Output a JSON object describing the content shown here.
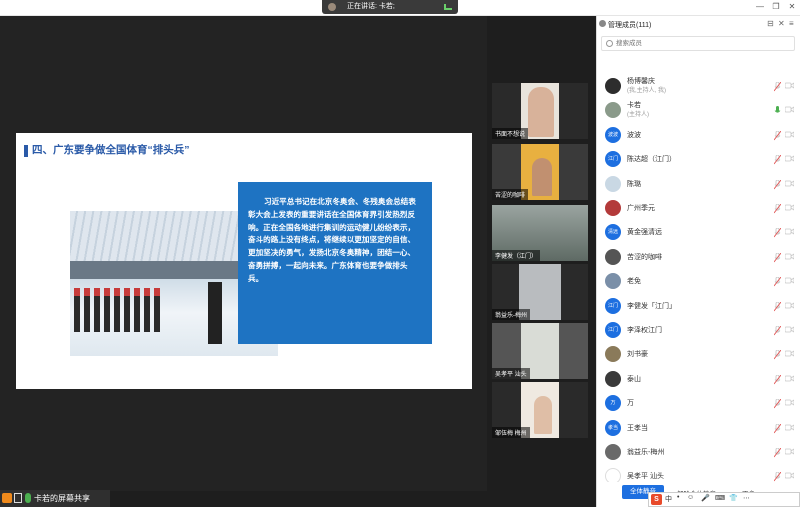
{
  "speaking_banner": {
    "text": "正在讲话: 卡若;"
  },
  "window_controls": [
    "—",
    "❐",
    "✕"
  ],
  "slide": {
    "title": "四、广东要争做全国体育“排头兵”",
    "body": "习近平总书记在北京冬奥会、冬残奥会总结表彰大会上发表的重要讲话在全国体育界引发热烈反响。正在全国各地进行集训的运动健儿纷纷表示，奋斗的路上没有终点，将继续以更加坚定的自信、更加坚决的勇气，发扬北京冬奥精神，团结一心、奋勇拼搏，一起向未来。广东体育也要争做排头兵。"
  },
  "video_tiles": [
    {
      "label": "书面不想说"
    },
    {
      "label": "苦涩的咖啡"
    },
    {
      "label": "李健发（江门）"
    },
    {
      "label": "翁益乐-梅州"
    },
    {
      "label": "吴孝平 汕头"
    },
    {
      "label": "邹伍梅 梅州"
    }
  ],
  "panel": {
    "title": "管理成员(111)",
    "search_placeholder": "搜索成员",
    "members": [
      {
        "name": "杨博馨庆",
        "sub": "(我,主持人, 我)",
        "avatar": "",
        "avatar_color": "#2d2d2d"
      },
      {
        "name": "卡若",
        "sub": "(主持人)",
        "avatar": "",
        "avatar_color": "#8a9a8a"
      },
      {
        "name": "波波",
        "sub": "",
        "avatar": "波波",
        "avatar_color": "#1d6fe0"
      },
      {
        "name": "陈达超（江门）",
        "sub": "",
        "avatar": "江门",
        "avatar_color": "#1d6fe0"
      },
      {
        "name": "陈璐",
        "sub": "",
        "avatar": "",
        "avatar_color": "#c9d8e4"
      },
      {
        "name": "广州季元",
        "sub": "",
        "avatar": "",
        "avatar_color": "#b33a3a"
      },
      {
        "name": "黄金强清远",
        "sub": "",
        "avatar": "清远",
        "avatar_color": "#1d6fe0"
      },
      {
        "name": "苦涩的咖啡",
        "sub": "",
        "avatar": "",
        "avatar_color": "#555"
      },
      {
        "name": "老免",
        "sub": "",
        "avatar": "",
        "avatar_color": "#7a8fa8"
      },
      {
        "name": "李健发「江门」",
        "sub": "",
        "avatar": "江门",
        "avatar_color": "#1d6fe0"
      },
      {
        "name": "李泽权江门",
        "sub": "",
        "avatar": "江门",
        "avatar_color": "#1d6fe0"
      },
      {
        "name": "刘书豪",
        "sub": "",
        "avatar": "",
        "avatar_color": "#8a7a5a"
      },
      {
        "name": "泰山",
        "sub": "",
        "avatar": "",
        "avatar_color": "#3a3a3a"
      },
      {
        "name": "万",
        "sub": "",
        "avatar": "万",
        "avatar_color": "#1d6fe0"
      },
      {
        "name": "王孝当",
        "sub": "",
        "avatar": "孝当",
        "avatar_color": "#1d6fe0"
      },
      {
        "name": "翁益乐-梅州",
        "sub": "",
        "avatar": "",
        "avatar_color": "#6a6a6a"
      },
      {
        "name": "吴孝平 汕头",
        "sub": "",
        "avatar": "",
        "avatar_color": "#ffffff"
      }
    ],
    "buttons": {
      "mute_all": "全体静音",
      "unmute_all": "解除全体静音",
      "more": "更多"
    }
  },
  "ime": {
    "logo": "S",
    "items": [
      "中",
      "•",
      "☺",
      "🎤",
      "⌨",
      "👕",
      "⋯"
    ]
  },
  "share_label": "卡若的屏幕共享"
}
